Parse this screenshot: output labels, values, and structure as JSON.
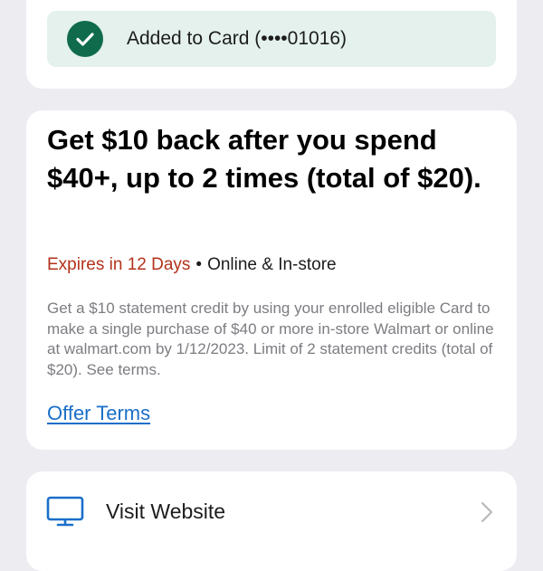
{
  "banner": {
    "added_text": "Added to Card (••••01016)",
    "accent_color": "#0f6b4b",
    "icon": "check-icon"
  },
  "offer": {
    "title": "Get $10 back after you spend $40+, up to 2 times (total of $20).",
    "expires": "Expires in 12 Days",
    "separator": "•",
    "channel": "Online & In-store",
    "description": "Get a $10 statement credit by using your enrolled eligible Card to make a single purchase of $40 or more in-store Walmart or online at walmart.com by 1/12/2023. Limit of 2 statement credits (total of $20). See terms.",
    "terms_link": "Offer Terms",
    "expires_color": "#b3321b",
    "link_color": "#1a6fc9"
  },
  "visit": {
    "label": "Visit Website",
    "icon": "monitor-icon",
    "chevron": "chevron-right-icon"
  }
}
